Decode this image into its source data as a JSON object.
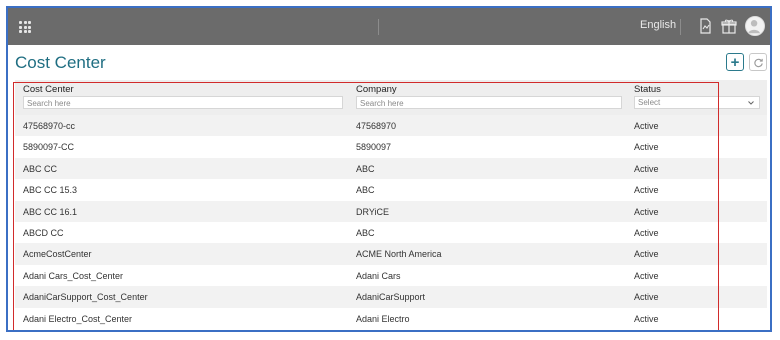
{
  "topbar": {
    "language": "English"
  },
  "page": {
    "title": "Cost Center"
  },
  "table": {
    "columns": [
      {
        "label": "Cost Center",
        "filter_placeholder": "Search here"
      },
      {
        "label": "Company",
        "filter_placeholder": "Search here"
      },
      {
        "label": "Status",
        "filter_placeholder": "Select"
      }
    ],
    "rows": [
      [
        "47568970-cc",
        "47568970",
        "Active"
      ],
      [
        "5890097-CC",
        "5890097",
        "Active"
      ],
      [
        "ABC CC",
        "ABC",
        "Active"
      ],
      [
        "ABC CC 15.3",
        "ABC",
        "Active"
      ],
      [
        "ABC CC 16.1",
        "DRYiCE",
        "Active"
      ],
      [
        "ABCD CC",
        "ABC",
        "Active"
      ],
      [
        "AcmeCostCenter",
        "ACME North America",
        "Active"
      ],
      [
        "Adani Cars_Cost_Center",
        "Adani Cars",
        "Active"
      ],
      [
        "AdaniCarSupport_Cost_Center",
        "AdaniCarSupport",
        "Active"
      ],
      [
        "Adani Electro_Cost_Center",
        "Adani Electro",
        "Active"
      ]
    ]
  },
  "icons": {
    "apps": "apps-grid-icon",
    "report": "report-icon",
    "gift": "gift-icon",
    "avatar": "user-avatar-icon",
    "add": "plus-icon",
    "refresh": "refresh-icon",
    "chevron": "chevron-down-icon"
  },
  "colors": {
    "topbar": "#6b6b6b",
    "title": "#1f6e82",
    "add_button": "#2b7a8c",
    "highlight_box": "#d12b2b",
    "frame_border": "#3b6fc4"
  }
}
